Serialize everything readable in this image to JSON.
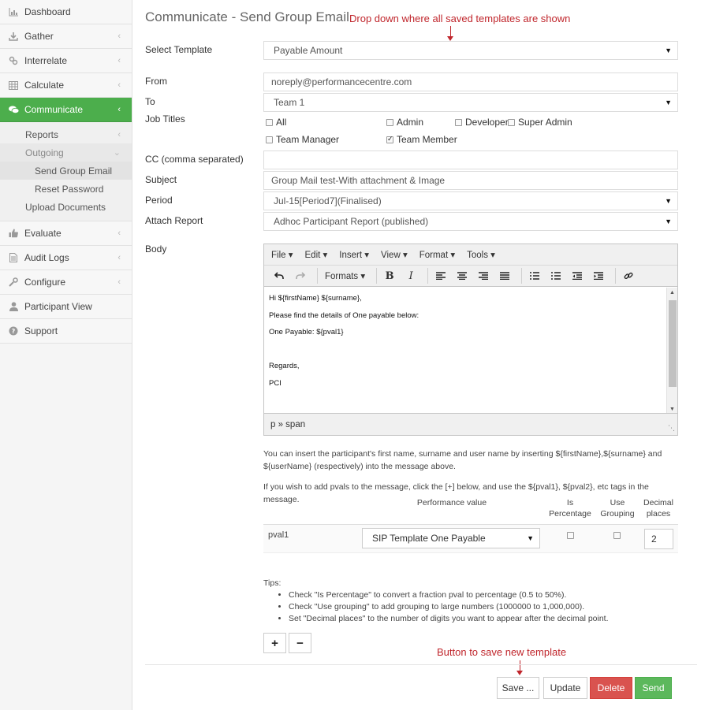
{
  "sidebar": {
    "items": [
      {
        "label": "Dashboard",
        "icon": "chart-bar-icon"
      },
      {
        "label": "Gather",
        "icon": "download-icon"
      },
      {
        "label": "Interrelate",
        "icon": "link-icon"
      },
      {
        "label": "Calculate",
        "icon": "table-icon"
      },
      {
        "label": "Communicate",
        "icon": "comments-icon"
      },
      {
        "label": "Evaluate",
        "icon": "thumbs-up-icon"
      },
      {
        "label": "Audit Logs",
        "icon": "file-icon"
      },
      {
        "label": "Configure",
        "icon": "wrench-icon"
      },
      {
        "label": "Participant View",
        "icon": "user-icon"
      },
      {
        "label": "Support",
        "icon": "question-circle-icon"
      }
    ],
    "sub": {
      "reports": "Reports",
      "outgoing": "Outgoing",
      "send_group_email": "Send Group Email",
      "reset_password": "Reset Password",
      "upload_documents": "Upload Documents"
    }
  },
  "page": {
    "title": "Communicate - Send Group Email",
    "annotation_top": "Drop down where all saved templates are shown",
    "annotation_bottom": "Button to save new template"
  },
  "form": {
    "select_template_label": "Select Template",
    "select_template_value": "Payable Amount",
    "from_label": "From",
    "from_value": "noreply@performancecentre.com",
    "to_label": "To",
    "to_value": "Team 1",
    "job_titles_label": "Job Titles",
    "job_titles": [
      {
        "label": "All",
        "checked": false
      },
      {
        "label": "Admin",
        "checked": false
      },
      {
        "label": "Developer",
        "checked": false
      },
      {
        "label": "Super Admin",
        "checked": false
      },
      {
        "label": "Team Manager",
        "checked": false
      },
      {
        "label": "Team Member",
        "checked": true
      }
    ],
    "cc_label": "CC (comma separated)",
    "cc_value": "",
    "subject_label": "Subject",
    "subject_value": "Group Mail test-With attachment & Image",
    "period_label": "Period",
    "period_value": "Jul-15[Period7](Finalised)",
    "attach_report_label": "Attach Report",
    "attach_report_value": "Adhoc Participant Report (published)",
    "body_label": "Body"
  },
  "editor": {
    "menu": [
      "File ▾",
      "Edit ▾",
      "Insert ▾",
      "View ▾",
      "Format ▾",
      "Tools ▾"
    ],
    "formats_label": "Formats ▾",
    "body_lines": [
      "Hi ${firstName} ${surname},",
      "Please find the details of One payable below:",
      "One Payable:  ${pval1}",
      "",
      "Regards,",
      "PCI"
    ],
    "status_path": "p » span"
  },
  "help": {
    "insert_text": "You can insert the participant's first name, surname and user name by inserting ${firstName},${surname} and ${userName} (respectively) into the message above.",
    "pvals_text": "If you wish to add pvals to the message, click the [+] below, and use the ${pval1}, ${pval2}, etc tags in the message."
  },
  "pvals": {
    "headers": {
      "performance_value": "Performance value",
      "is_percentage": "Is\nPercentage",
      "use_grouping": "Use\nGrouping",
      "decimal_places": "Decimal\nplaces"
    },
    "rows": [
      {
        "name": "pval1",
        "value": "SIP Template One Payable",
        "is_percentage": false,
        "use_grouping": false,
        "decimal_places": "2"
      }
    ]
  },
  "tips": {
    "title": "Tips:",
    "items": [
      "Check \"Is Percentage\" to convert a fraction pval to percentage (0.5 to 50%).",
      "Check \"Use grouping\" to add grouping to large numbers (1000000 to 1,000,000).",
      "Set \"Decimal places\" to the number of digits you want to appear after the decimal point."
    ]
  },
  "buttons": {
    "add": "+",
    "remove": "−",
    "save": "Save ...",
    "update": "Update",
    "delete": "Delete",
    "send": "Send"
  }
}
